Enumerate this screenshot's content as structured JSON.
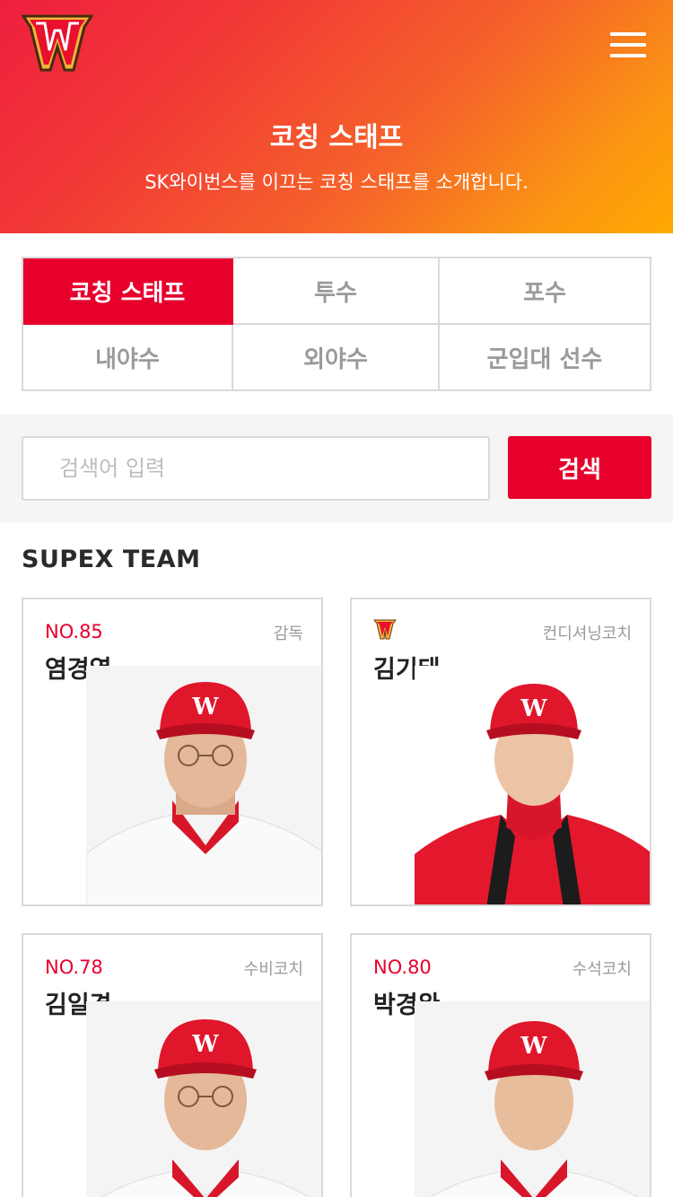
{
  "header": {
    "logo_icon": "wyverns-w-logo-icon",
    "menu_icon": "hamburger-menu-icon",
    "title": "코칭 스태프",
    "subtitle": "SK와이번스를 이끄는 코칭 스태프를 소개합니다."
  },
  "tabs": [
    {
      "label": "코칭 스태프",
      "active": true
    },
    {
      "label": "투수",
      "active": false
    },
    {
      "label": "포수",
      "active": false
    },
    {
      "label": "내야수",
      "active": false
    },
    {
      "label": "외야수",
      "active": false
    },
    {
      "label": "군입대 선수",
      "active": false
    }
  ],
  "search": {
    "placeholder": "검색어 입력",
    "value": "",
    "button_label": "검색"
  },
  "section": {
    "title": "SUPEX TEAM"
  },
  "coaches": [
    {
      "number": "NO.85",
      "role": "감독",
      "name": "염경엽",
      "jersey": "uniform"
    },
    {
      "number": "",
      "role": "컨디셔닝코치",
      "name": "김기태",
      "jersey": "jacket",
      "number_icon": "wyverns-mini-logo-icon"
    },
    {
      "number": "NO.78",
      "role": "수비코치",
      "name": "김일경",
      "jersey": "uniform"
    },
    {
      "number": "NO.80",
      "role": "수석코치",
      "name": "박경완",
      "jersey": "uniform"
    }
  ],
  "colors": {
    "accent": "#e8002d",
    "header_gradient_start": "#ee1f3e",
    "header_gradient_end": "#ffa800",
    "border": "#d9d9d9",
    "muted_text": "#9a9a9a"
  }
}
